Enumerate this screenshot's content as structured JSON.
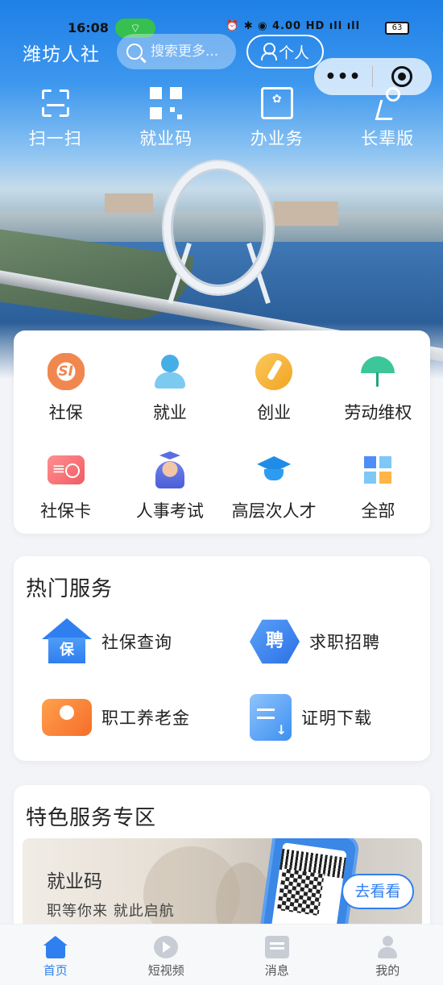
{
  "status_bar": {
    "time": "16:08",
    "net_speed": "4.00",
    "battery": "63"
  },
  "header": {
    "title": "潍坊人社",
    "search_placeholder": "搜索更多...",
    "personal_label": "个人"
  },
  "quick_actions": [
    {
      "label": "扫一扫",
      "icon": "scan-icon"
    },
    {
      "label": "就业码",
      "icon": "qr-code-icon"
    },
    {
      "label": "办业务",
      "icon": "document-icon"
    },
    {
      "label": "长辈版",
      "icon": "elder-mode-icon"
    }
  ],
  "services": [
    {
      "label": "社保",
      "icon": "social-security-icon"
    },
    {
      "label": "就业",
      "icon": "employment-icon"
    },
    {
      "label": "创业",
      "icon": "entrepreneurship-icon"
    },
    {
      "label": "劳动维权",
      "icon": "labor-rights-umbrella-icon"
    },
    {
      "label": "社保卡",
      "icon": "social-security-card-icon"
    },
    {
      "label": "人事考试",
      "icon": "exam-icon"
    },
    {
      "label": "高层次人才",
      "icon": "graduation-cap-icon"
    },
    {
      "label": "全部",
      "icon": "all-grid-icon"
    }
  ],
  "hot_services": {
    "title": "热门服务",
    "items": [
      {
        "label": "社保查询",
        "icon": "house-icon"
      },
      {
        "label": "求职招聘",
        "icon": "recruit-icon"
      },
      {
        "label": "职工养老金",
        "icon": "pension-icon"
      },
      {
        "label": "证明下载",
        "icon": "certificate-download-icon"
      }
    ]
  },
  "featured": {
    "title": "特色服务专区",
    "banner": {
      "title": "就业码",
      "subtitle": "职等你来  就此启航",
      "button": "去看看"
    }
  },
  "tabbar": [
    {
      "label": "首页",
      "icon": "home-icon",
      "active": true
    },
    {
      "label": "短视频",
      "icon": "video-icon",
      "active": false
    },
    {
      "label": "消息",
      "icon": "message-icon",
      "active": false
    },
    {
      "label": "我的",
      "icon": "profile-icon",
      "active": false
    }
  ],
  "colors": {
    "accent": "#2f7ff0",
    "background": "#f2f4f8"
  }
}
